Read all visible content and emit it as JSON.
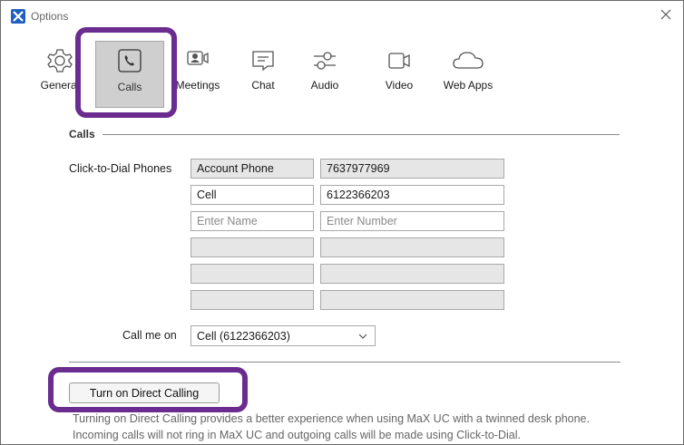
{
  "window": {
    "title": "Options"
  },
  "tabs": [
    {
      "label": "General",
      "icon": "gear-icon"
    },
    {
      "label": "Calls",
      "icon": "phone-icon",
      "active": true
    },
    {
      "label": "Meetings",
      "icon": "meeting-icon"
    },
    {
      "label": "Chat",
      "icon": "chat-icon"
    },
    {
      "label": "Audio",
      "icon": "sliders-icon"
    },
    {
      "label": "Video",
      "icon": "video-camera-icon"
    },
    {
      "label": "Web Apps",
      "icon": "cloud-icon"
    }
  ],
  "calls": {
    "section_title": "Calls",
    "click_to_dial_label": "Click-to-Dial Phones",
    "phones": [
      {
        "name": "Account Phone",
        "number": "7637977969",
        "readonly": true
      },
      {
        "name": "Cell",
        "number": "6122366203"
      },
      {
        "name": "",
        "number": "",
        "name_placeholder": "Enter Name",
        "number_placeholder": "Enter Number"
      },
      {
        "name": "",
        "number": "",
        "disabled": true
      },
      {
        "name": "",
        "number": "",
        "disabled": true
      },
      {
        "name": "",
        "number": "",
        "disabled": true
      }
    ],
    "call_me_on_label": "Call me on",
    "call_me_on_value": "Cell (6122366203)",
    "direct_calling_button": "Turn on Direct Calling",
    "direct_calling_description": "Turning on Direct Calling provides a better experience when using MaX UC with a twinned desk phone. Incoming calls will not ring in MaX UC and outgoing calls will be made using Click-to-Dial."
  },
  "colors": {
    "highlight": "#6a2c8e",
    "active_tab_bg": "#cfcfcf",
    "readonly_field_bg": "#e6e6e6",
    "app_icon": "#1f5fbf"
  }
}
